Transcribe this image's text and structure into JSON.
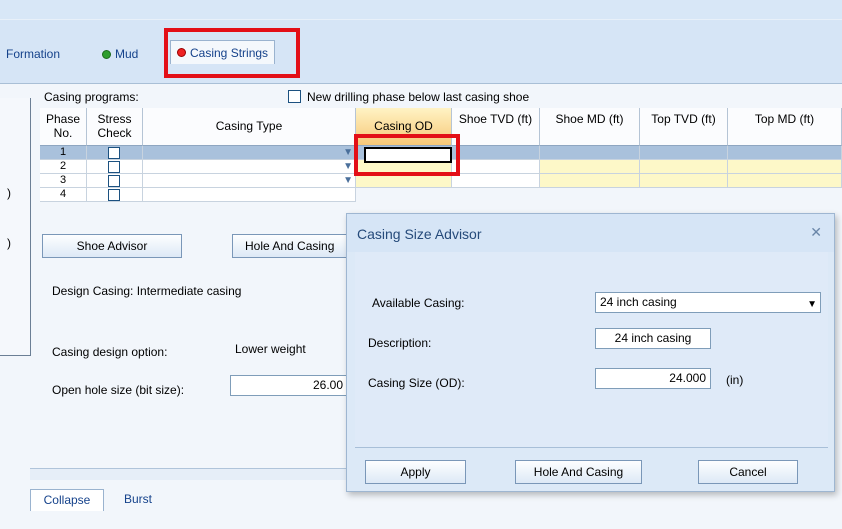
{
  "tabs": [
    {
      "label": "Formation",
      "status_color": null
    },
    {
      "label": "Mud",
      "status_color": "#2e9d2e"
    },
    {
      "label": "Casing Strings",
      "status_color": "#e22222"
    }
  ],
  "casing": {
    "programs_label": "Casing programs:",
    "new_phase_label": "New drilling phase below last casing shoe",
    "columns": [
      "Phase No.",
      "Stress Check",
      "Casing Type",
      "Casing OD",
      "Shoe TVD (ft)",
      "Shoe MD (ft)",
      "Top TVD (ft)",
      "Top MD (ft)"
    ],
    "rows": [
      {
        "phase": "1"
      },
      {
        "phase": "2"
      },
      {
        "phase": "3"
      },
      {
        "phase": "4"
      }
    ],
    "shoe_advisor": "Shoe Advisor",
    "hole_and_casing": "Hole And Casing",
    "design_casing": "Design Casing:  Intermediate casing",
    "design_option_label": "Casing design option:",
    "design_option_value": "Lower weight",
    "open_hole_label": "Open hole size (bit size):",
    "open_hole_value": "26.00"
  },
  "bottom_tabs": [
    "Collapse",
    "Burst"
  ],
  "dialog": {
    "title": "Casing Size Advisor",
    "available_label": "Available Casing:",
    "available_value": "24 inch casing",
    "description_label": "Description:",
    "description_value": "24 inch casing",
    "size_label": "Casing Size (OD):",
    "size_value": "24.000",
    "size_unit": "(in)",
    "apply": "Apply",
    "hole_and_casing": "Hole And Casing",
    "cancel": "Cancel"
  },
  "colors": {
    "highlight": "#e30f17",
    "grid_yellow": "#fdf8c8",
    "selected_row": "#a9c1dc"
  }
}
